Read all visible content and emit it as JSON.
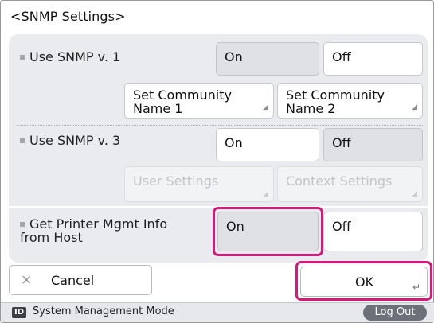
{
  "title": "<SNMP Settings>",
  "rows": {
    "snmp_v1": {
      "label": "Use SNMP v. 1",
      "on": "On",
      "off": "Off",
      "community1_line1": "Set Community",
      "community1_line2": "Name 1",
      "community2_line1": "Set Community",
      "community2_line2": "Name 2"
    },
    "snmp_v3": {
      "label": "Use SNMP v. 3",
      "on": "On",
      "off": "Off",
      "user_settings": "User Settings",
      "context_settings": "Context Settings"
    },
    "printer_mgmt": {
      "label_line1": "Get Printer Mgmt Info",
      "label_line2": "from Host",
      "on": "On",
      "off": "Off"
    }
  },
  "bottom": {
    "cancel": "Cancel",
    "cancel_icon": "×",
    "ok": "OK"
  },
  "status_bar": {
    "badge": "ID",
    "mode": "System Management Mode",
    "logout": "Log Out"
  },
  "colors": {
    "highlight": "#d6187a",
    "panel": "#e9ebef"
  }
}
